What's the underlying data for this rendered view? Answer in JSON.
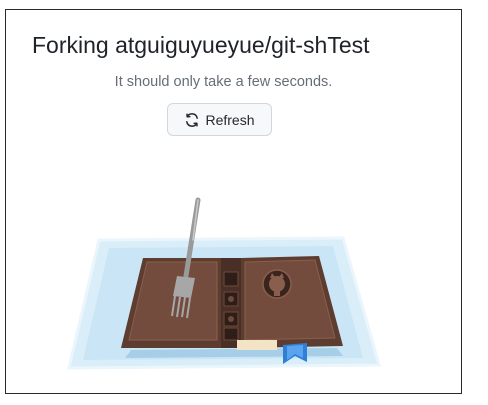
{
  "heading": "Forking atguiguyueyue/git-shTest",
  "message": "It should only take a few seconds.",
  "refresh_button": {
    "label": "Refresh",
    "icon": "refresh-icon"
  },
  "illustration": {
    "description_icon": "fork-on-book-illustration"
  },
  "colors": {
    "text_primary": "#1f2328",
    "text_muted": "#656d76",
    "button_bg": "#f6f8fa",
    "button_border": "#d0d7de",
    "book_brown": "#6b4638",
    "plate_blue": "#cfe8f7",
    "fork_gray": "#9a9a9a",
    "bookmark_blue": "#2f7fd6"
  }
}
